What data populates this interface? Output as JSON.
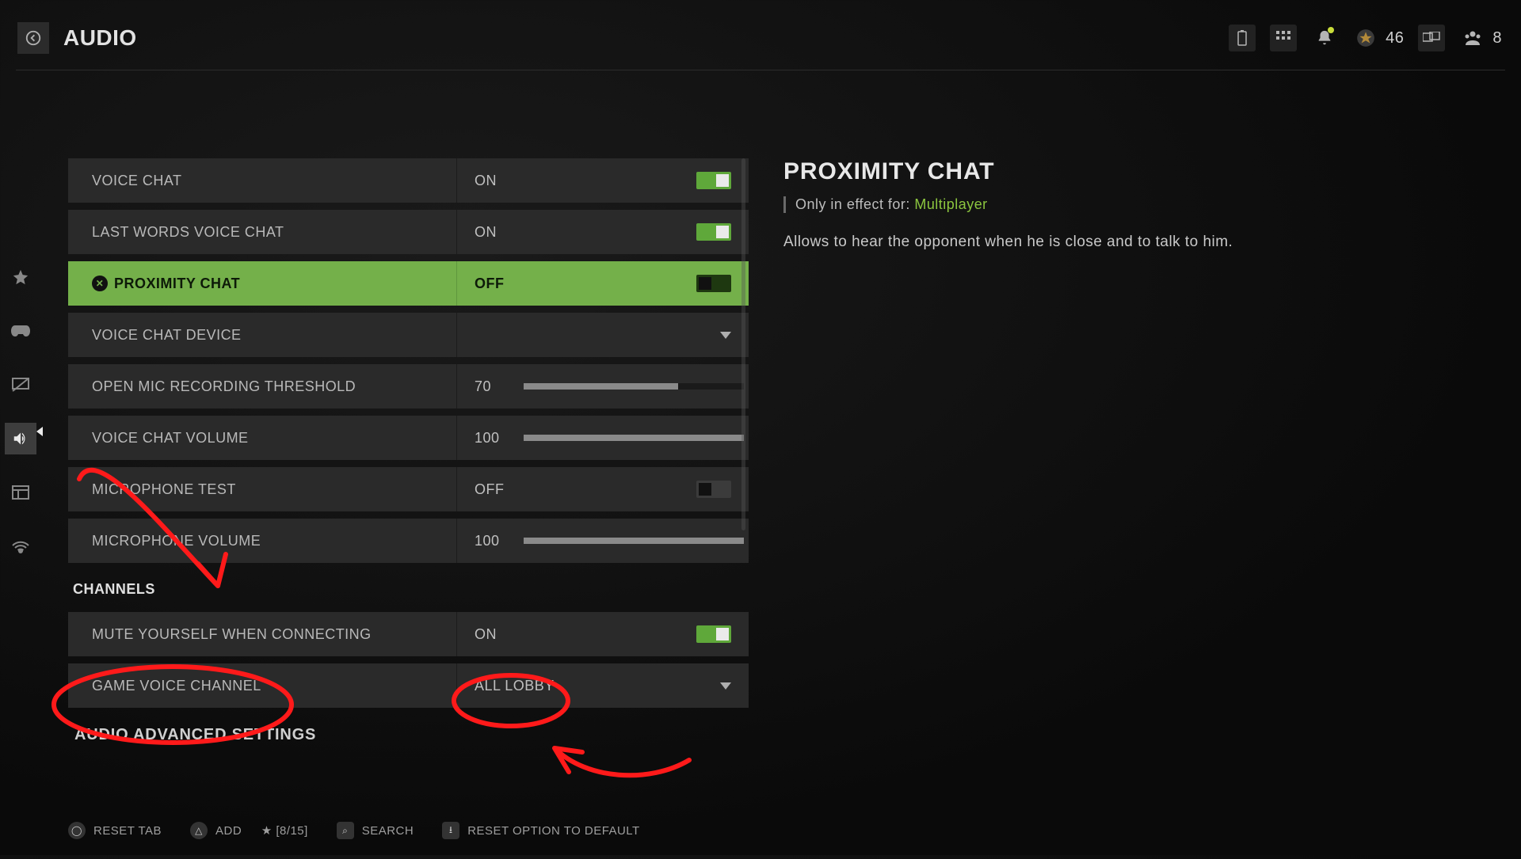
{
  "header": {
    "title": "AUDIO",
    "points": "46",
    "party": "8"
  },
  "sidebar": {
    "items": [
      {
        "icon": "star"
      },
      {
        "icon": "controller"
      },
      {
        "icon": "display"
      },
      {
        "icon": "audio",
        "active": true
      },
      {
        "icon": "interface"
      },
      {
        "icon": "network"
      }
    ]
  },
  "settings": [
    {
      "kind": "toggle",
      "label": "VOICE CHAT",
      "value": "ON",
      "on": true
    },
    {
      "kind": "toggle",
      "label": "LAST WORDS VOICE CHAT",
      "value": "ON",
      "on": true
    },
    {
      "kind": "toggle",
      "label": "PROXIMITY CHAT",
      "value": "OFF",
      "on": false,
      "selected": true
    },
    {
      "kind": "dropdown",
      "label": "VOICE CHAT DEVICE",
      "value": ""
    },
    {
      "kind": "slider",
      "label": "OPEN MIC RECORDING THRESHOLD",
      "value": "70",
      "pct": 70
    },
    {
      "kind": "slider",
      "label": "VOICE CHAT VOLUME",
      "value": "100",
      "pct": 100
    },
    {
      "kind": "toggle",
      "label": "MICROPHONE TEST",
      "value": "OFF",
      "on": false
    },
    {
      "kind": "slider",
      "label": "MICROPHONE VOLUME",
      "value": "100",
      "pct": 100
    }
  ],
  "section2_title": "CHANNELS",
  "settings2": [
    {
      "kind": "toggle",
      "label": "MUTE YOURSELF WHEN CONNECTING",
      "value": "ON",
      "on": true
    },
    {
      "kind": "dropdown",
      "label": "GAME VOICE CHANNEL",
      "value": "ALL LOBBY"
    }
  ],
  "advanced_label": "AUDIO ADVANCED SETTINGS",
  "detail": {
    "title": "PROXIMITY CHAT",
    "note_prefix": "Only in effect for: ",
    "note_hl": "Multiplayer",
    "desc": "Allows to hear the opponent when he is close and to talk to him."
  },
  "footer": {
    "reset_tab": "RESET TAB",
    "add": "ADD",
    "add_count": "★ [8/15]",
    "search": "SEARCH",
    "reset_default": "RESET OPTION TO DEFAULT"
  }
}
